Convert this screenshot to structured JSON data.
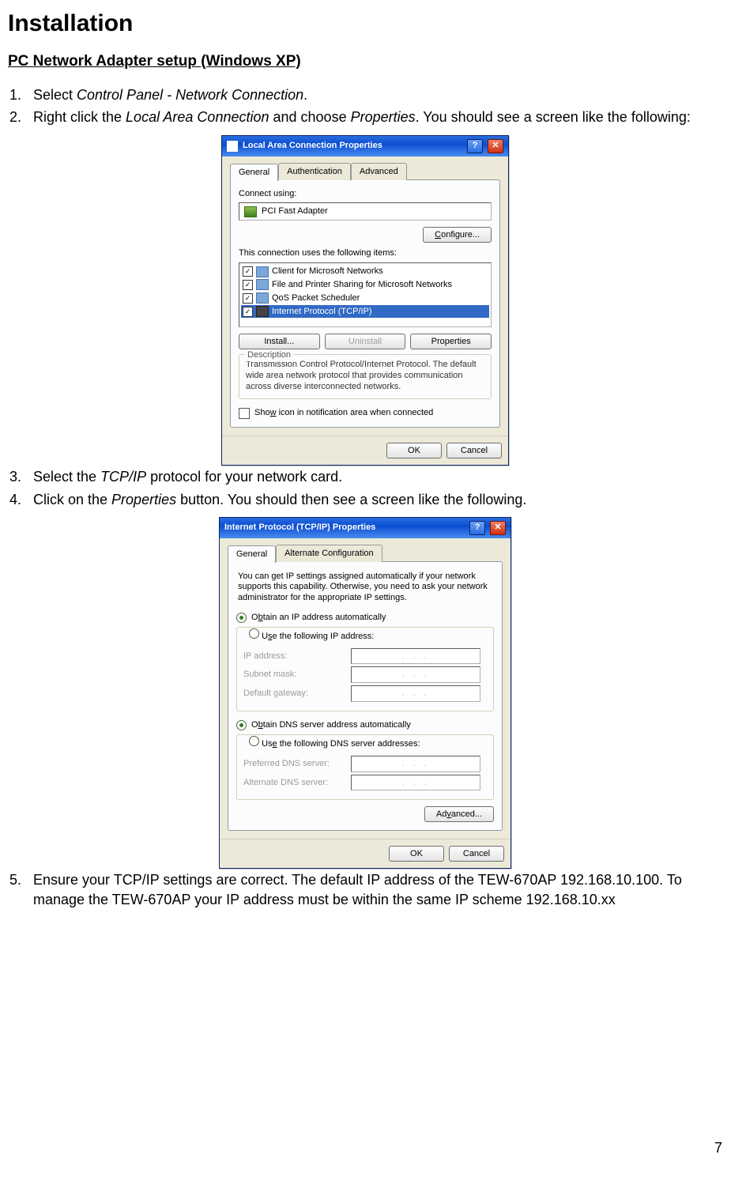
{
  "page": {
    "title": "Installation",
    "subtitle": "PC Network Adapter setup (Windows XP)",
    "page_number": "7"
  },
  "steps": {
    "s1_a": "Select ",
    "s1_i": "Control Panel - Network Connection",
    "s1_b": ".",
    "s2_a": "Right click the ",
    "s2_i": "Local Area Connection",
    "s2_b": " and choose ",
    "s2_i2": "Properties",
    "s2_c": ". You should see a screen like the following:",
    "s3_a": "Select the ",
    "s3_i": "TCP/IP",
    "s3_b": " protocol for your network card.",
    "s4_a": "Click on the ",
    "s4_i": "Properties",
    "s4_b": " button. You should then see a screen like the following.",
    "s5": "Ensure your TCP/IP settings are correct. The default IP address of the TEW-670AP 192.168.10.100. To manage the TEW-670AP your IP address must be within the same IP scheme 192.168.10.xx"
  },
  "dlg1": {
    "title": "Local Area Connection Properties",
    "tabs": {
      "general": "General",
      "auth": "Authentication",
      "adv": "Advanced"
    },
    "connect_using": "Connect using:",
    "adapter": "PCI Fast Adapter",
    "configure": "Configure...",
    "items_label": "This connection uses the following items:",
    "items": {
      "i0": "Client for Microsoft Networks",
      "i1": "File and Printer Sharing for Microsoft Networks",
      "i2": "QoS Packet Scheduler",
      "i3": "Internet Protocol (TCP/IP)"
    },
    "install": "Install...",
    "uninstall": "Uninstall",
    "properties": "Properties",
    "desc_legend": "Description",
    "desc_text": "Transmission Control Protocol/Internet Protocol. The default wide area network protocol that provides communication across diverse interconnected networks.",
    "show_icon_pre": "Sho",
    "show_icon_u": "w",
    "show_icon_post": " icon in notification area when connected",
    "ok": "OK",
    "cancel": "Cancel",
    "help": "?",
    "close": "✕",
    "check": "✓"
  },
  "dlg2": {
    "title": "Internet Protocol (TCP/IP) Properties",
    "tabs": {
      "general": "General",
      "alt": "Alternate Configuration"
    },
    "intro": "You can get IP settings assigned automatically if your network supports this capability. Otherwise, you need to ask your network administrator for the appropriate IP settings.",
    "r_obtain_pre": "O",
    "r_obtain_u": "b",
    "r_obtain_post": "tain an IP address automatically",
    "r_useip_pre": "U",
    "r_useip_u": "s",
    "r_useip_post": "e the following IP address:",
    "ip_addr": "IP address:",
    "subnet": "Subnet mask:",
    "gateway": "Default gateway:",
    "r_obtain_dns_pre": "O",
    "r_obtain_dns_u": "b",
    "r_obtain_dns_post": "tain DNS server address automatically",
    "r_usedns_pre": "Us",
    "r_usedns_u": "e",
    "r_usedns_post": " the following DNS server addresses:",
    "pref_dns": "Preferred DNS server:",
    "alt_dns": "Alternate DNS server:",
    "advanced_pre": "Ad",
    "advanced_u": "v",
    "advanced_post": "anced...",
    "ok": "OK",
    "cancel": "Cancel",
    "help": "?",
    "close": "✕",
    "dots": ".   .   ."
  }
}
